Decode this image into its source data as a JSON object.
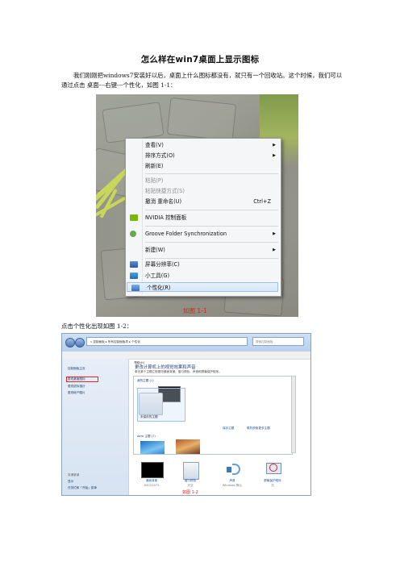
{
  "title": "怎么样在win7桌面上显示图标",
  "intro": "我们刚刚把windows7安装好以后，桌面上什么图标都没有，就只有一个回收站。这个时候，我们可以通过点击 桌面---右键---个性化，如图 1-1：",
  "figure1": {
    "caption": "如图 1-1",
    "menu_items": [
      {
        "label": "查看(V)",
        "submenu": true
      },
      {
        "label": "排序方式(O)",
        "submenu": true
      },
      {
        "label": "刷新(E)"
      },
      {
        "label": "粘贴(P)",
        "disabled": true
      },
      {
        "label": "粘贴快捷方式(S)",
        "disabled": true
      },
      {
        "label": "撤消 重命名(U)",
        "shortcut": "Ctrl+Z"
      },
      {
        "label": "NVIDIA 控制面板",
        "icon": "nvidia-icon"
      },
      {
        "label": "Groove Folder Synchronization",
        "submenu": true,
        "icon": "groove-icon"
      },
      {
        "label": "新建(W)",
        "submenu": true
      },
      {
        "label": "屏幕分辨率(C)",
        "icon": "screen-resolution-icon"
      },
      {
        "label": "小工具(G)",
        "icon": "gadgets-icon"
      },
      {
        "label": "个性化(R)",
        "icon": "personalize-icon",
        "selected": true
      }
    ],
    "submenu_arrow": "▶"
  },
  "click_text": "点击个性化出现如图 1-2：",
  "figure2": {
    "caption": "如图 1-2",
    "address_path": "« 控制面板 ▸ 所有控制面板项 ▸ 个性化",
    "search_placeholder": "搜索控制面板",
    "menubar": [
      "文件(F)",
      "编辑(E)",
      "查看(V)",
      "工具(T)",
      "帮助(H)"
    ],
    "sidebar_links": [
      "控制面板主页",
      "更改桌面图标",
      "更改鼠标指针",
      "更改帐户图片"
    ],
    "sidebar_bottom_heading": "另请参阅",
    "sidebar_bottom_links": [
      "显示",
      "任务栏和「开始」菜单"
    ],
    "heading": "更改计算机上的视觉效果和声音",
    "subheading": "单击某个主题立即更改桌面背景、窗口颜色、声音和屏幕保护程序。",
    "my_themes_label": "我的主题 (1)",
    "unsaved_theme": "未保存的主题",
    "save_theme_link": "保存主题",
    "online_theme_link": "联机获取更多主题",
    "aero_label": "Aero 主题 (7)",
    "bottom_items": [
      {
        "label": "桌面背景",
        "sub": "DSC02072"
      },
      {
        "label": "窗口颜色",
        "sub": "天空"
      },
      {
        "label": "声音",
        "sub": "Windows 默认"
      },
      {
        "label": "屏幕保护程序",
        "sub": "无"
      }
    ]
  }
}
